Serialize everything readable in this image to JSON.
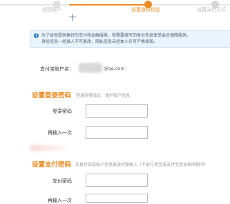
{
  "steps": [
    {
      "label": "创建账户",
      "state": "done"
    },
    {
      "label": "设置身份信息",
      "state": "active"
    },
    {
      "label": "设置支付方式",
      "state": "todo"
    }
  ],
  "colors": {
    "accent": "#f08a22",
    "info": "#2f7dc8",
    "notice_bg": "#eaf4fc"
  },
  "notice": {
    "icon": "info-icon",
    "line1": "为了给你提供更好的支付和金融服务，你需要填写的身份信息享受会员保障服务。",
    "line2": "身份信息一经录入不可更改，隐私信息未经本人许可严格保密。"
  },
  "account": {
    "label": "支付宝账户名：",
    "domain": "@qq.com"
  },
  "login_pwd": {
    "title": "设置登录密码",
    "hint": "登录时需验证，保护账户信息",
    "fields": [
      {
        "label": "登录密码",
        "value": ""
      },
      {
        "label": "再输入一次",
        "value": ""
      }
    ]
  },
  "pay_pwd": {
    "title": "设置支付密码",
    "hint": "交易付款或账户信息更改时需输入（不能与淘宝或支付宝登录密码相同）",
    "fields": [
      {
        "label": "支付密码",
        "value": ""
      },
      {
        "label": "再输入一次",
        "value": ""
      }
    ]
  }
}
